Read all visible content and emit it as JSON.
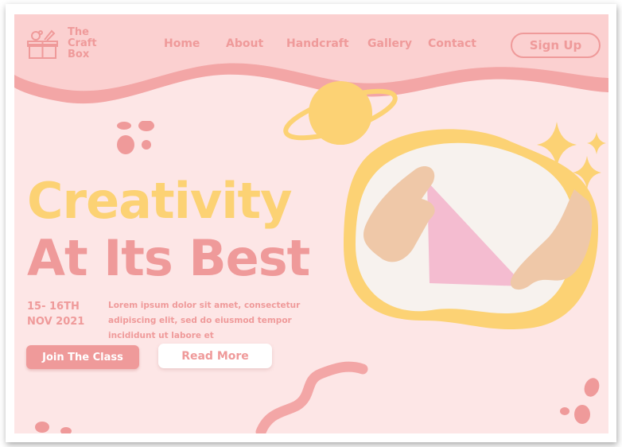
{
  "brand": {
    "logo_icon": "craft-box-icon",
    "line1": "The",
    "line2": "Craft",
    "line3": "Box"
  },
  "nav": {
    "items": [
      {
        "label": "Home"
      },
      {
        "label": "About"
      },
      {
        "label": "Handcraft"
      },
      {
        "label": "Gallery"
      },
      {
        "label": "Contact"
      }
    ],
    "signup_label": "Sign Up"
  },
  "hero": {
    "headline_line1": "Creativity",
    "headline_line2": "At Its Best",
    "date": "15- 16TH\nNOV 2021",
    "description": "Lorem ipsum dolor sit amet, consectetur adipiscing elit, sed do eiusmod tempor incididunt ut labore et",
    "join_label": "Join The Class",
    "read_more_label": "Read More",
    "image_subject": "hands folding pink paper"
  },
  "colors": {
    "background": "#fde6e6",
    "pink": "#ef9a9a",
    "yellow": "#fcd274",
    "header_pink": "#fbd0d0"
  }
}
